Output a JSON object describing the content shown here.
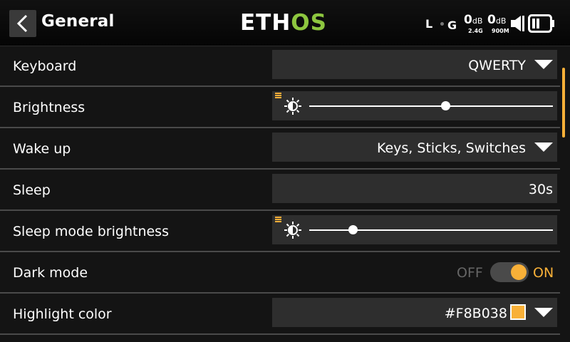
{
  "header": {
    "title": "General",
    "logo_white": "ETH",
    "logo_green": "OS",
    "logo_green_color": "#8dc63f",
    "rx1": "L",
    "rx2": "G",
    "rssi1": {
      "value": "0",
      "unit": "dB",
      "band": "2.4G"
    },
    "rssi2": {
      "value": "0",
      "unit": "dB",
      "band": "900M"
    },
    "speaker_icon": "speaker-volume-icon",
    "battery_icon": "battery-icon"
  },
  "accent_color": "#f8b038",
  "settings": {
    "keyboard": {
      "label": "Keyboard",
      "value": "QWERTY"
    },
    "brightness": {
      "label": "Brightness",
      "level": 0.56
    },
    "wake_up": {
      "label": "Wake up",
      "value": "Keys, Sticks, Switches"
    },
    "sleep": {
      "label": "Sleep",
      "value": "30s"
    },
    "sleep_brightness": {
      "label": "Sleep mode brightness",
      "level": 0.18
    },
    "dark_mode": {
      "label": "Dark mode",
      "off_label": "OFF",
      "on_label": "ON",
      "state": true
    },
    "highlight_color": {
      "label": "Highlight color",
      "value": "#F8B038",
      "swatch": "#F8B038"
    }
  }
}
